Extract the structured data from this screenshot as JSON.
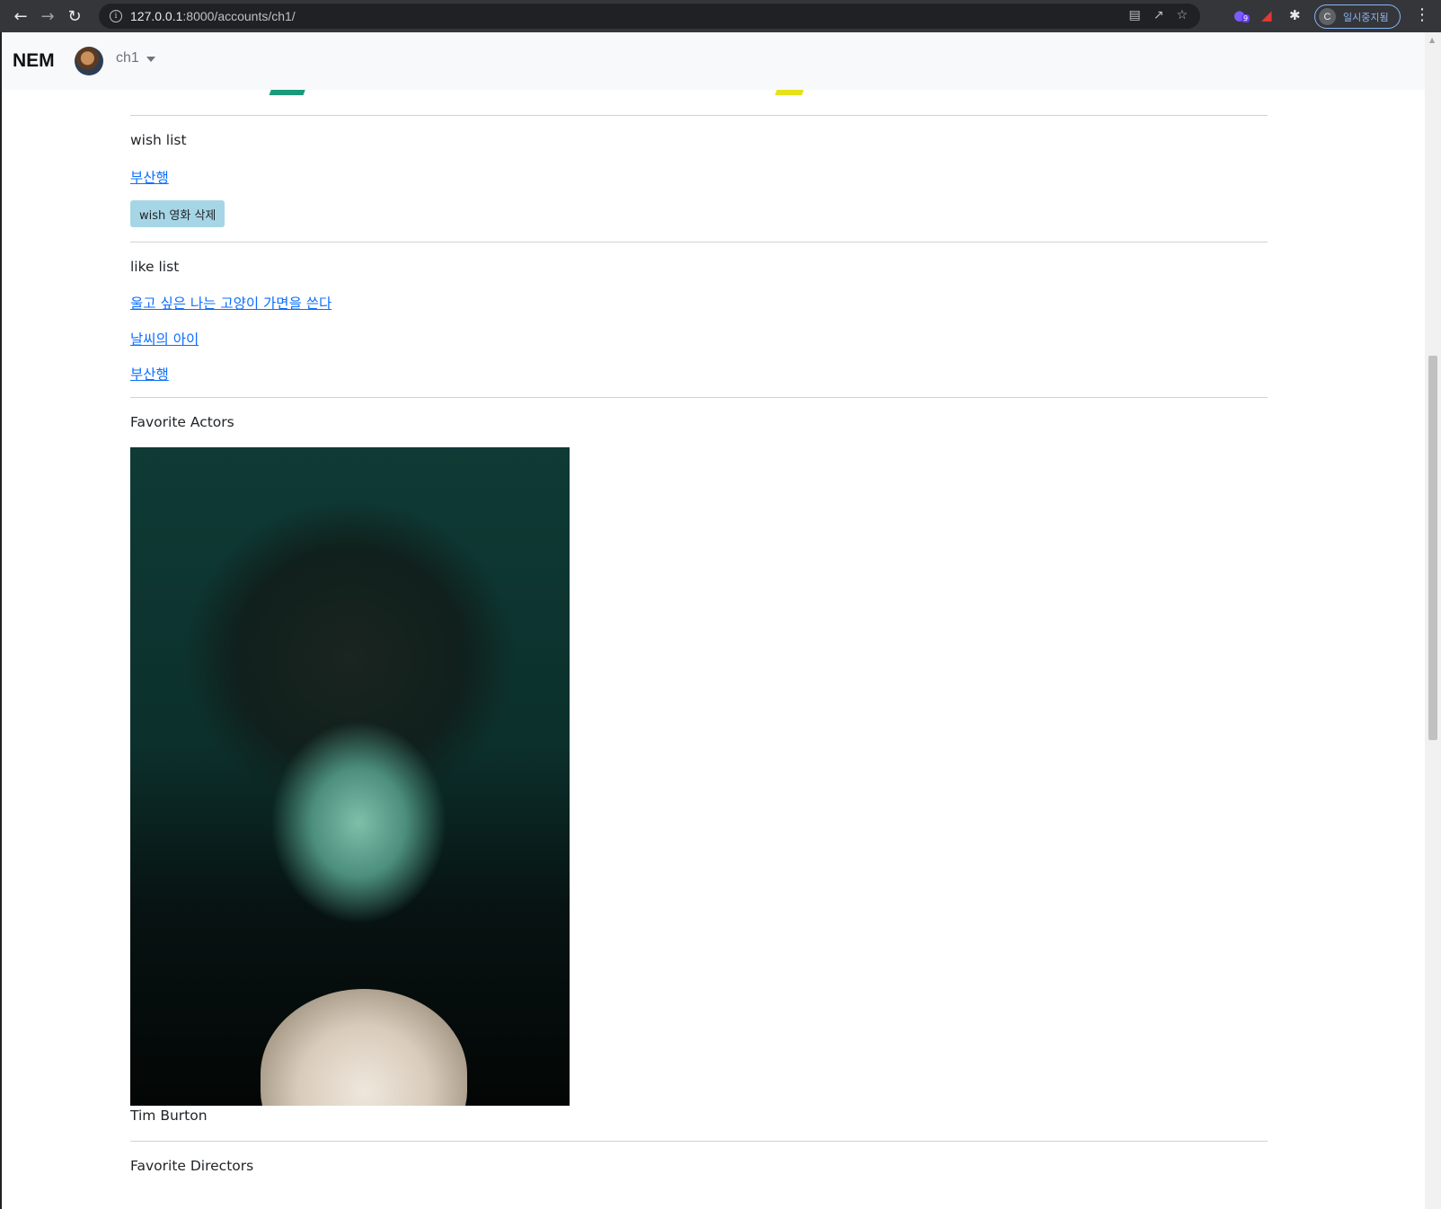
{
  "browser": {
    "url_host": "127.0.0.1",
    "url_rest": ":8000/accounts/ch1/",
    "profile_initial": "C",
    "profile_label": "일시중지됨",
    "extension_badge": "9"
  },
  "navbar": {
    "brand": "NEM",
    "username": "ch1"
  },
  "wish": {
    "heading": "wish list",
    "movies": [
      "부산행"
    ],
    "delete_button": "wish 영화 삭제"
  },
  "like": {
    "heading": "like list",
    "movies": [
      "울고 싶은 나는 고양이 가면을 쓴다",
      "날씨의 아이",
      "부산행"
    ]
  },
  "actors": {
    "heading": "Favorite Actors",
    "items": [
      {
        "name": "Tim Burton"
      }
    ]
  },
  "directors": {
    "heading": "Favorite Directors"
  },
  "colors": {
    "link": "#0d6efd",
    "button": "#a6d6e6",
    "navbar_bg": "#f8f9fa",
    "sliver_teal": "#1a9a7a",
    "sliver_yellow": "#e6e21a"
  }
}
